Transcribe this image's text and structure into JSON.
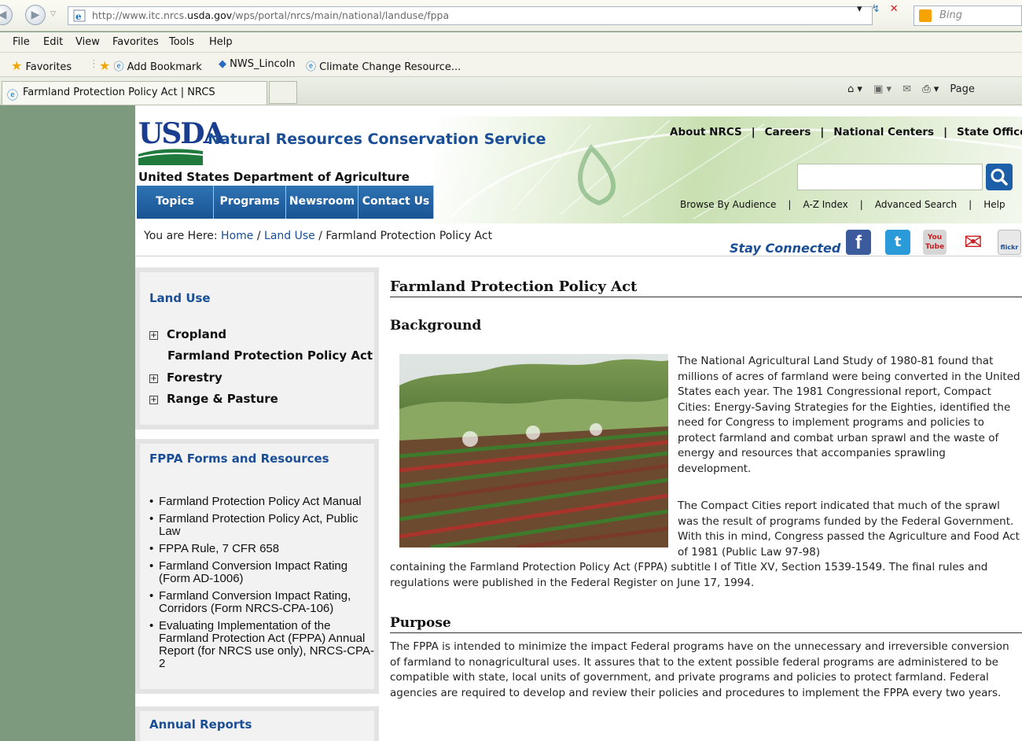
{
  "browser": {
    "url_prefix": "http://www.itc.nrcs.",
    "url_domain": "usda.gov",
    "url_path": "/wps/portal/nrcs/main/national/landuse/fppa",
    "search_engine": "Bing",
    "menu": [
      "File",
      "Edit",
      "View",
      "Favorites",
      "Tools",
      "Help"
    ],
    "favorites_label": "Favorites",
    "bookmarks": [
      "Add Bookmark",
      "NWS_Lincoln",
      "Climate Change Resource..."
    ],
    "tab_title": "Farmland Protection Policy Act | NRCS",
    "page_menu": "Page"
  },
  "header": {
    "logo": "USDA",
    "agency": "Natural Resources Conservation Service",
    "department": "United States Department of Agriculture",
    "nav": [
      "Topics",
      "Programs",
      "Newsroom",
      "Contact Us"
    ],
    "top_links": [
      "About NRCS",
      "Careers",
      "National Centers",
      "State Offices"
    ],
    "search_placeholder": "",
    "lower_links": [
      "Browse By Audience",
      "A-Z Index",
      "Advanced Search",
      "Help"
    ]
  },
  "breadcrumb": {
    "prefix": "You are Here:",
    "home": "Home",
    "section": "Land Use",
    "current": "Farmland Protection Policy Act"
  },
  "social": {
    "label": "Stay Connected",
    "icons": [
      "facebook-icon",
      "twitter-icon",
      "youtube-icon",
      "email-icon",
      "flickr-icon"
    ]
  },
  "sidebar": {
    "land_use": {
      "title": "Land Use",
      "items": [
        "Cropland",
        "Farmland Protection Policy Act",
        "Forestry",
        "Range & Pasture"
      ]
    },
    "forms": {
      "title": "FPPA Forms and Resources",
      "items": [
        "Farmland Protection Policy Act Manual",
        "Farmland Protection Policy Act, Public Law",
        "FPPA Rule, 7 CFR 658",
        "Farmland Conversion Impact Rating (Form AD-1006)",
        "Farmland Conversion Impact Rating, Corridors (Form NRCS-CPA-106)",
        "Evaluating Implementation of the Farmland Protection Act (FPPA) Annual Report (for NRCS use only), NRCS-CPA-2"
      ]
    },
    "reports": {
      "title": "Annual Reports"
    }
  },
  "content": {
    "title": "Farmland Protection Policy Act",
    "background_heading": "Background",
    "para1": "The National Agricultural Land Study of 1980-81 found that millions of acres of farmland were being converted in the United States each year. The 1981 Congressional report, Compact Cities: Energy-Saving Strategies for the Eighties, identified the need for Congress to implement programs and policies to protect farmland and combat urban sprawl and the waste of energy and resources that accompanies sprawling development.",
    "para2_wrapped": "The Compact Cities report indicated that much of the sprawl was the result of programs funded by the Federal Government. With this in mind, Congress passed the Agriculture and Food Act of 1981 (Public Law 97-98)",
    "para2_rest": "containing the Farmland Protection Policy Act (FPPA) subtitle I of Title XV, Section 1539-1549. The final rules and regulations were published in the Federal Register on June 17, 1994.",
    "purpose_heading": "Purpose",
    "para3": "The FPPA is intended to minimize the impact Federal programs have on the unnecessary and irreversible conversion of farmland to nonagricultural uses. It assures that to the extent possible federal programs are administered to be compatible with state, local units of government, and private programs and policies to protect farmland. Federal agencies are required to develop and review their policies and procedures to implement the FPPA every two years."
  },
  "colors": {
    "link_blue": "#1a4e96",
    "nav_blue": "#195494",
    "outer_bg": "#7d9a7e"
  }
}
